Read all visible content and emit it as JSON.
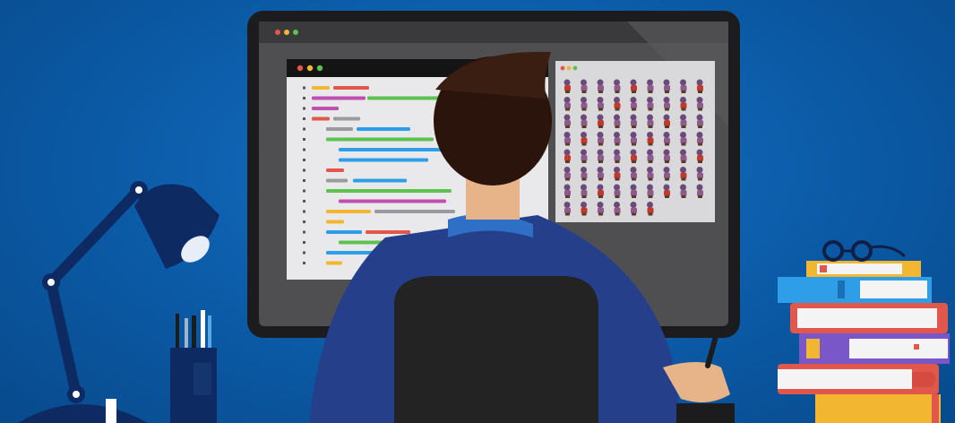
{
  "scene": {
    "description_free": true,
    "colors": {
      "background": "#0b5aa6",
      "monitor_bezel": "#1c1c1e",
      "screen": "#5a5a5c",
      "code_panel": "#e9e9ec",
      "code_header": "#141414",
      "sprite_panel": "#d9d9dc",
      "jacket": "#263f8a",
      "hair": "#2a140c",
      "skin": "#e7b48a",
      "chair": "#232323",
      "lamp": "#0e2a63",
      "accent_red": "#e2574c",
      "accent_yellow": "#f2b630",
      "accent_green": "#5cc24f"
    },
    "icons": {
      "window_dots": [
        "red-dot",
        "yellow-dot",
        "green-dot"
      ],
      "glasses": "glasses-icon",
      "lamp": "desk-lamp-icon",
      "pen_cup": "pen-cup-icon",
      "books": "book-stack-icon",
      "stylus": "stylus-icon"
    }
  }
}
